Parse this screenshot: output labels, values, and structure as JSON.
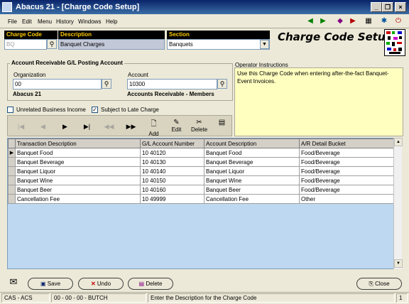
{
  "window": {
    "title": "Abacus 21 - [Charge Code Setup]"
  },
  "menu": [
    "File",
    "Edit",
    "Menu",
    "History",
    "Windows",
    "Help"
  ],
  "header": {
    "charge_code_label": "Charge Code",
    "charge_code_value": "BQ",
    "description_label": "Description",
    "description_value": "Banquet Charges",
    "section_label": "Section",
    "section_value": "Banquets",
    "screen_title": "Charge Code Setup"
  },
  "ar_account": {
    "group_title": "Account Receivable G/L Posting Account",
    "org_label": "Organization",
    "org_value": "00",
    "org_name": "Abacus 21",
    "acct_label": "Account",
    "acct_value": "10300",
    "acct_name": "Accounts Receivable - Members"
  },
  "operator": {
    "label": "Operator Instructions",
    "text": "Use this Charge Code when entering after-the-fact Banquet-Event Invoices."
  },
  "options": {
    "unrelated_label": "Unrelated Business Income",
    "unrelated_checked": false,
    "late_charge_label": "Subject to Late Charge",
    "late_charge_checked": true
  },
  "nav": {
    "add": "Add",
    "edit": "Edit",
    "delete": "Delete",
    "filter": "Filter"
  },
  "grid": {
    "columns": [
      "Transaction Description",
      "G/L Account Number",
      "Account Description",
      "A/R Detail Bucket"
    ],
    "rows": [
      [
        "Banquet Food",
        "10 40120",
        "Banquet Food",
        "Food/Beverage"
      ],
      [
        "Banquet Beverage",
        "10 40130",
        "Banquet Beverage",
        "Food/Beverage"
      ],
      [
        "Banquet Liquor",
        "10 40140",
        "Banquet Liquor",
        "Food/Beverage"
      ],
      [
        "Banquet Wine",
        "10 40150",
        "Banquet Wine",
        "Food/Beverage"
      ],
      [
        "Banquet Beer",
        "10 40160",
        "Banquet Beer",
        "Food/Beverage"
      ],
      [
        "Cancellation Fee",
        "10 49999",
        "Cancellation Fee",
        "Other"
      ]
    ]
  },
  "buttons": {
    "save": "Save",
    "undo": "Undo",
    "delete": "Delete",
    "close": "Close"
  },
  "status": {
    "company": "CAS - ACS",
    "user": "00 - 00 - 00 - BUTCH",
    "hint": "Enter the Description for the Charge Code",
    "count": "1"
  },
  "colors": {
    "title_bar": "#0a246a",
    "header_label_bg": "#000000",
    "header_label_text": "#ffcc00",
    "grid_bg": "#bdd8f0",
    "operator_bg": "#ffffc0"
  }
}
